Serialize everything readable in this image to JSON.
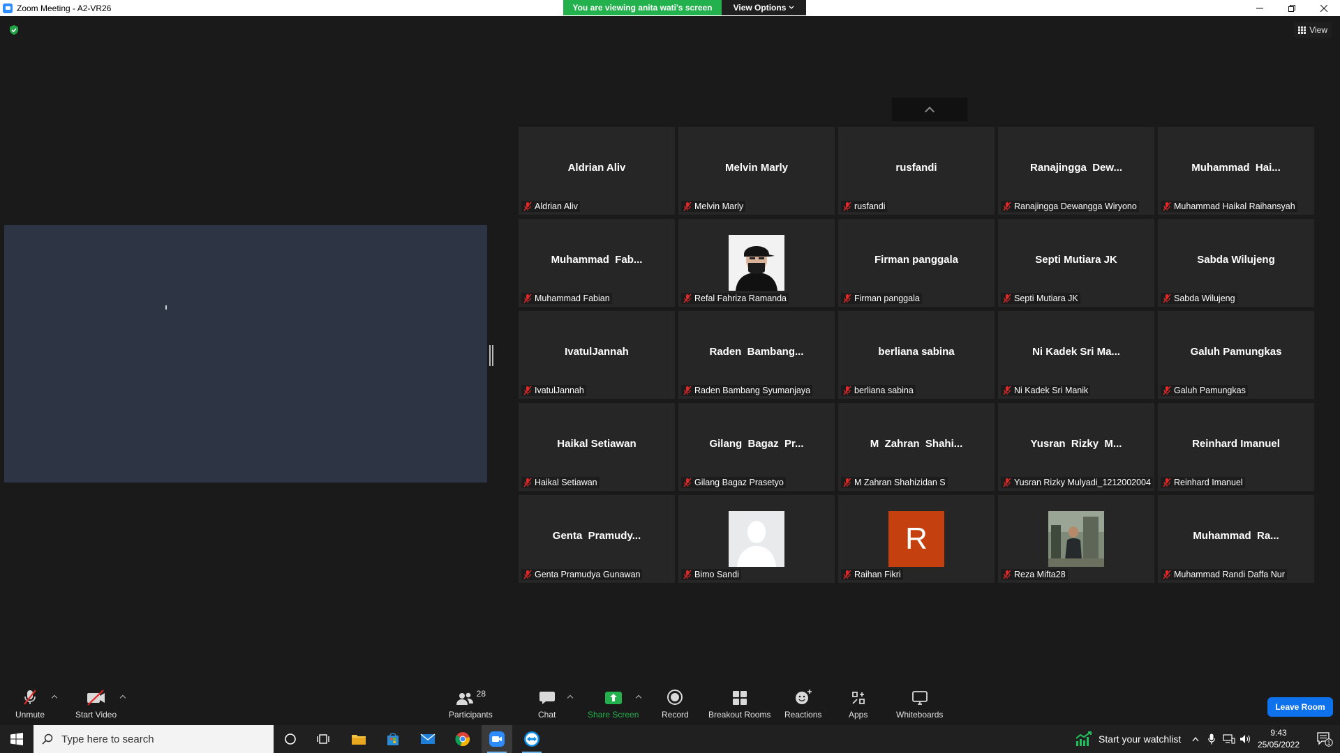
{
  "window": {
    "title": "Zoom Meeting - A2-VR26"
  },
  "banner": {
    "viewing_text": "You are viewing anita wati's screen",
    "view_options_label": "View Options"
  },
  "top_right": {
    "view_label": "View"
  },
  "participants": [
    {
      "display": "Aldrian Aliv",
      "name": "Aldrian Aliv"
    },
    {
      "display": "Melvin Marly",
      "name": "Melvin Marly"
    },
    {
      "display": "rusfandi",
      "name": "rusfandi"
    },
    {
      "display": "Ranajingga  Dew...",
      "name": "Ranajingga Dewangga Wiryono"
    },
    {
      "display": "Muhammad  Hai...",
      "name": "Muhammad Haikal Raihansyah"
    },
    {
      "display": "Muhammad  Fab...",
      "name": "Muhammad Fabian"
    },
    {
      "display": "",
      "name": "Refal Fahriza Ramanda",
      "avatar": "masked-person-photo"
    },
    {
      "display": "Firman panggala",
      "name": "Firman panggala"
    },
    {
      "display": "Septi Mutiara JK",
      "name": "Septi Mutiara JK"
    },
    {
      "display": "Sabda Wilujeng",
      "name": "Sabda Wilujeng"
    },
    {
      "display": "IvatulJannah",
      "name": "IvatulJannah"
    },
    {
      "display": "Raden  Bambang...",
      "name": "Raden Bambang Syumanjaya"
    },
    {
      "display": "berliana sabina",
      "name": "berliana sabina"
    },
    {
      "display": "Ni Kadek Sri Ma...",
      "name": "Ni Kadek Sri Manik"
    },
    {
      "display": "Galuh Pamungkas",
      "name": "Galuh Pamungkas"
    },
    {
      "display": "Haikal Setiawan",
      "name": "Haikal Setiawan"
    },
    {
      "display": "Gilang  Bagaz  Pr...",
      "name": "Gilang Bagaz Prasetyo"
    },
    {
      "display": "M  Zahran  Shahi...",
      "name": "M Zahran Shahizidan S"
    },
    {
      "display": "Yusran  Rizky  M...",
      "name": "Yusran Rizky Mulyadi_1212002004"
    },
    {
      "display": "Reinhard Imanuel",
      "name": "Reinhard Imanuel"
    },
    {
      "display": "Genta  Pramudy...",
      "name": "Genta Pramudya Gunawan"
    },
    {
      "display": "",
      "name": "Bimo Sandi",
      "avatar": "default-silhouette"
    },
    {
      "display": "",
      "name": "Raihan Fikri",
      "avatar": "letter",
      "avatar_letter": "R",
      "avatar_color": "#c4410f"
    },
    {
      "display": "",
      "name": "Reza Mifta28",
      "avatar": "outdoor-photo"
    },
    {
      "display": "Muhammad  Ra...",
      "name": "Muhammad Randi Daffa Nur"
    }
  ],
  "toolbar": {
    "unmute": "Unmute",
    "start_video": "Start Video",
    "participants_label": "Participants",
    "participants_count": "28",
    "chat": "Chat",
    "share_screen": "Share Screen",
    "record": "Record",
    "breakout_rooms": "Breakout Rooms",
    "reactions": "Reactions",
    "apps": "Apps",
    "whiteboards": "Whiteboards",
    "leave_room": "Leave Room"
  },
  "taskbar": {
    "search_placeholder": "Type here to search",
    "watchlist": "Start your watchlist",
    "time": "9:43",
    "date": "25/05/2022",
    "notification_count": "1"
  },
  "colors": {
    "banner_green": "#22b14c",
    "share_green": "#22b14c",
    "leave_blue": "#0e72ed",
    "mute_red": "#e02828"
  }
}
